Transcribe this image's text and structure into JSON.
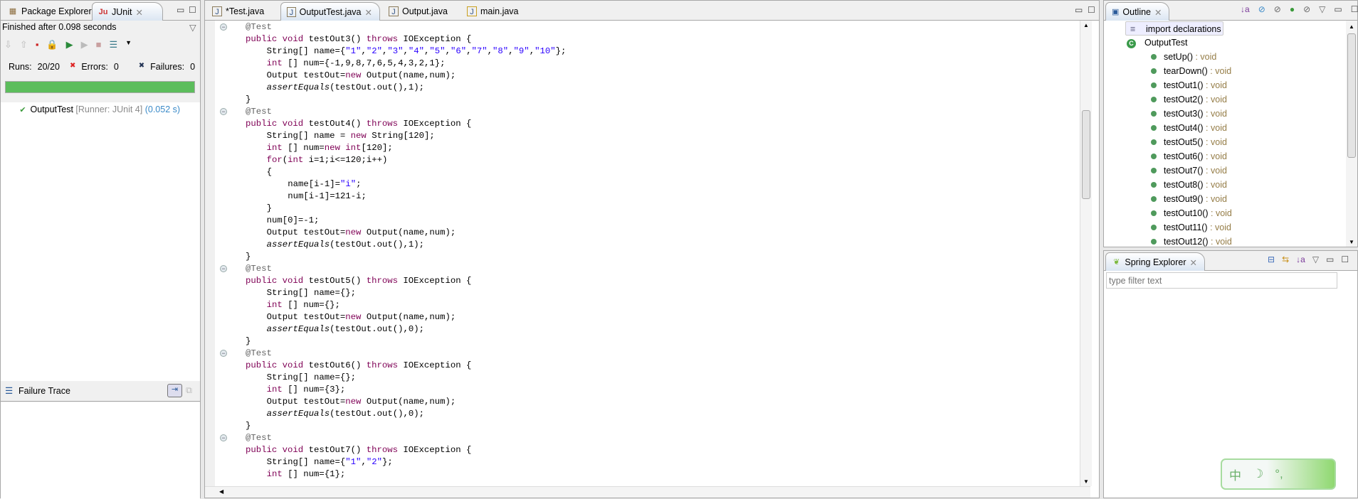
{
  "left_panel": {
    "tabs": [
      {
        "label": "Package Explorer",
        "icon": "package-explorer-icon"
      },
      {
        "label": "JUnit",
        "icon": "junit-icon",
        "active": true
      }
    ],
    "status": "Finished after 0.098 seconds",
    "runs_label": "Runs:",
    "runs_value": "20/20",
    "errors_label": "Errors:",
    "errors_value": "0",
    "failures_label": "Failures:",
    "failures_value": "0",
    "progress_percent": 100,
    "progress_color": "#5cbd5c",
    "tree": {
      "name": "OutputTest",
      "runner": "[Runner: JUnit 4]",
      "time": "(0.052 s)"
    },
    "failure_trace_label": "Failure Trace"
  },
  "editor": {
    "tabs": [
      {
        "label": "*Test.java"
      },
      {
        "label": "OutputTest.java",
        "active": true
      },
      {
        "label": "Output.java"
      },
      {
        "label": "main.java"
      }
    ],
    "lines": [
      [
        0,
        [
          [
            "an",
            "@Test"
          ]
        ]
      ],
      [
        0,
        [
          [
            "kw",
            "public void "
          ],
          [
            "",
            "testOut3() "
          ],
          [
            "kw",
            "throws "
          ],
          [
            "",
            "IOException {"
          ]
        ]
      ],
      [
        1,
        [
          [
            "",
            "String[] name={"
          ],
          [
            "st",
            "\"1\""
          ],
          [
            "",
            ","
          ],
          [
            "st",
            "\"2\""
          ],
          [
            "",
            ","
          ],
          [
            "st",
            "\"3\""
          ],
          [
            "",
            ","
          ],
          [
            "st",
            "\"4\""
          ],
          [
            "",
            ","
          ],
          [
            "st",
            "\"5\""
          ],
          [
            "",
            ","
          ],
          [
            "st",
            "\"6\""
          ],
          [
            "",
            ","
          ],
          [
            "st",
            "\"7\""
          ],
          [
            "",
            ","
          ],
          [
            "st",
            "\"8\""
          ],
          [
            "",
            ","
          ],
          [
            "st",
            "\"9\""
          ],
          [
            "",
            ","
          ],
          [
            "st",
            "\"10\""
          ],
          [
            "",
            "};"
          ]
        ]
      ],
      [
        1,
        [
          [
            "kw",
            "int "
          ],
          [
            "",
            "[] num={-1,9,8,7,6,5,4,3,2,1};"
          ]
        ]
      ],
      [
        1,
        [
          [
            "",
            "Output testOut="
          ],
          [
            "kw",
            "new "
          ],
          [
            "",
            "Output(name,num);"
          ]
        ]
      ],
      [
        1,
        [
          [
            "it",
            "assertEquals"
          ],
          [
            "",
            "(testOut.out(),1);"
          ]
        ]
      ],
      [
        0,
        [
          [
            "",
            "}"
          ]
        ]
      ],
      [
        0,
        [
          [
            "an",
            "@Test"
          ]
        ]
      ],
      [
        0,
        [
          [
            "kw",
            "public void "
          ],
          [
            "",
            "testOut4() "
          ],
          [
            "kw",
            "throws "
          ],
          [
            "",
            "IOException {"
          ]
        ]
      ],
      [
        1,
        [
          [
            "",
            "String[] name = "
          ],
          [
            "kw",
            "new "
          ],
          [
            "",
            "String[120];"
          ]
        ]
      ],
      [
        1,
        [
          [
            "kw",
            "int "
          ],
          [
            "",
            "[] num="
          ],
          [
            "kw",
            "new int"
          ],
          [
            "",
            "[120];"
          ]
        ]
      ],
      [
        1,
        [
          [
            "kw",
            "for"
          ],
          [
            "",
            "("
          ],
          [
            "kw",
            "int "
          ],
          [
            "",
            "i=1;i<=120;i++)"
          ]
        ]
      ],
      [
        1,
        [
          [
            "",
            "{"
          ]
        ]
      ],
      [
        2,
        [
          [
            "",
            "name[i-1]="
          ],
          [
            "st",
            "\"i\""
          ],
          [
            "",
            ";"
          ]
        ]
      ],
      [
        2,
        [
          [
            "",
            "num[i-1]=121-i;"
          ]
        ]
      ],
      [
        1,
        [
          [
            "",
            "}"
          ]
        ]
      ],
      [
        1,
        [
          [
            "",
            "num[0]=-1;"
          ]
        ]
      ],
      [
        1,
        [
          [
            "",
            "Output testOut="
          ],
          [
            "kw",
            "new "
          ],
          [
            "",
            "Output(name,num);"
          ]
        ]
      ],
      [
        1,
        [
          [
            "it",
            "assertEquals"
          ],
          [
            "",
            "(testOut.out(),1);"
          ]
        ]
      ],
      [
        0,
        [
          [
            "",
            "}"
          ]
        ]
      ],
      [
        0,
        [
          [
            "an",
            "@Test"
          ]
        ]
      ],
      [
        0,
        [
          [
            "kw",
            "public void "
          ],
          [
            "",
            "testOut5() "
          ],
          [
            "kw",
            "throws "
          ],
          [
            "",
            "IOException {"
          ]
        ]
      ],
      [
        1,
        [
          [
            "",
            "String[] name={};"
          ]
        ]
      ],
      [
        1,
        [
          [
            "kw",
            "int "
          ],
          [
            "",
            "[] num={};"
          ]
        ]
      ],
      [
        1,
        [
          [
            "",
            "Output testOut="
          ],
          [
            "kw",
            "new "
          ],
          [
            "",
            "Output(name,num);"
          ]
        ]
      ],
      [
        1,
        [
          [
            "it",
            "assertEquals"
          ],
          [
            "",
            "(testOut.out(),0);"
          ]
        ]
      ],
      [
        0,
        [
          [
            "",
            "}"
          ]
        ]
      ],
      [
        0,
        [
          [
            "an",
            "@Test"
          ]
        ]
      ],
      [
        0,
        [
          [
            "kw",
            "public void "
          ],
          [
            "",
            "testOut6() "
          ],
          [
            "kw",
            "throws "
          ],
          [
            "",
            "IOException {"
          ]
        ]
      ],
      [
        1,
        [
          [
            "",
            "String[] name={};"
          ]
        ]
      ],
      [
        1,
        [
          [
            "kw",
            "int "
          ],
          [
            "",
            "[] num={3};"
          ]
        ]
      ],
      [
        1,
        [
          [
            "",
            "Output testOut="
          ],
          [
            "kw",
            "new "
          ],
          [
            "",
            "Output(name,num);"
          ]
        ]
      ],
      [
        1,
        [
          [
            "it",
            "assertEquals"
          ],
          [
            "",
            "(testOut.out(),0);"
          ]
        ]
      ],
      [
        0,
        [
          [
            "",
            "}"
          ]
        ]
      ],
      [
        0,
        [
          [
            "an",
            "@Test"
          ]
        ]
      ],
      [
        0,
        [
          [
            "kw",
            "public void "
          ],
          [
            "",
            "testOut7() "
          ],
          [
            "kw",
            "throws "
          ],
          [
            "",
            "IOException {"
          ]
        ]
      ],
      [
        1,
        [
          [
            "",
            "String[] name={"
          ],
          [
            "st",
            "\"1\""
          ],
          [
            "",
            ","
          ],
          [
            "st",
            "\"2\""
          ],
          [
            "",
            "};"
          ]
        ]
      ],
      [
        1,
        [
          [
            "kw",
            "int "
          ],
          [
            "",
            "[] num={1};"
          ]
        ]
      ]
    ]
  },
  "outline": {
    "title": "Outline",
    "imports": "import declarations",
    "class_name": "OutputTest",
    "methods": [
      "setUp()",
      "tearDown()",
      "testOut1()",
      "testOut2()",
      "testOut3()",
      "testOut4()",
      "testOut5()",
      "testOut6()",
      "testOut7()",
      "testOut8()",
      "testOut9()",
      "testOut10()",
      "testOut11()",
      "testOut12()"
    ],
    "return_type": " : void"
  },
  "spring": {
    "title": "Spring Explorer",
    "filter_placeholder": "type filter text"
  },
  "ime": {
    "mode": "中"
  }
}
